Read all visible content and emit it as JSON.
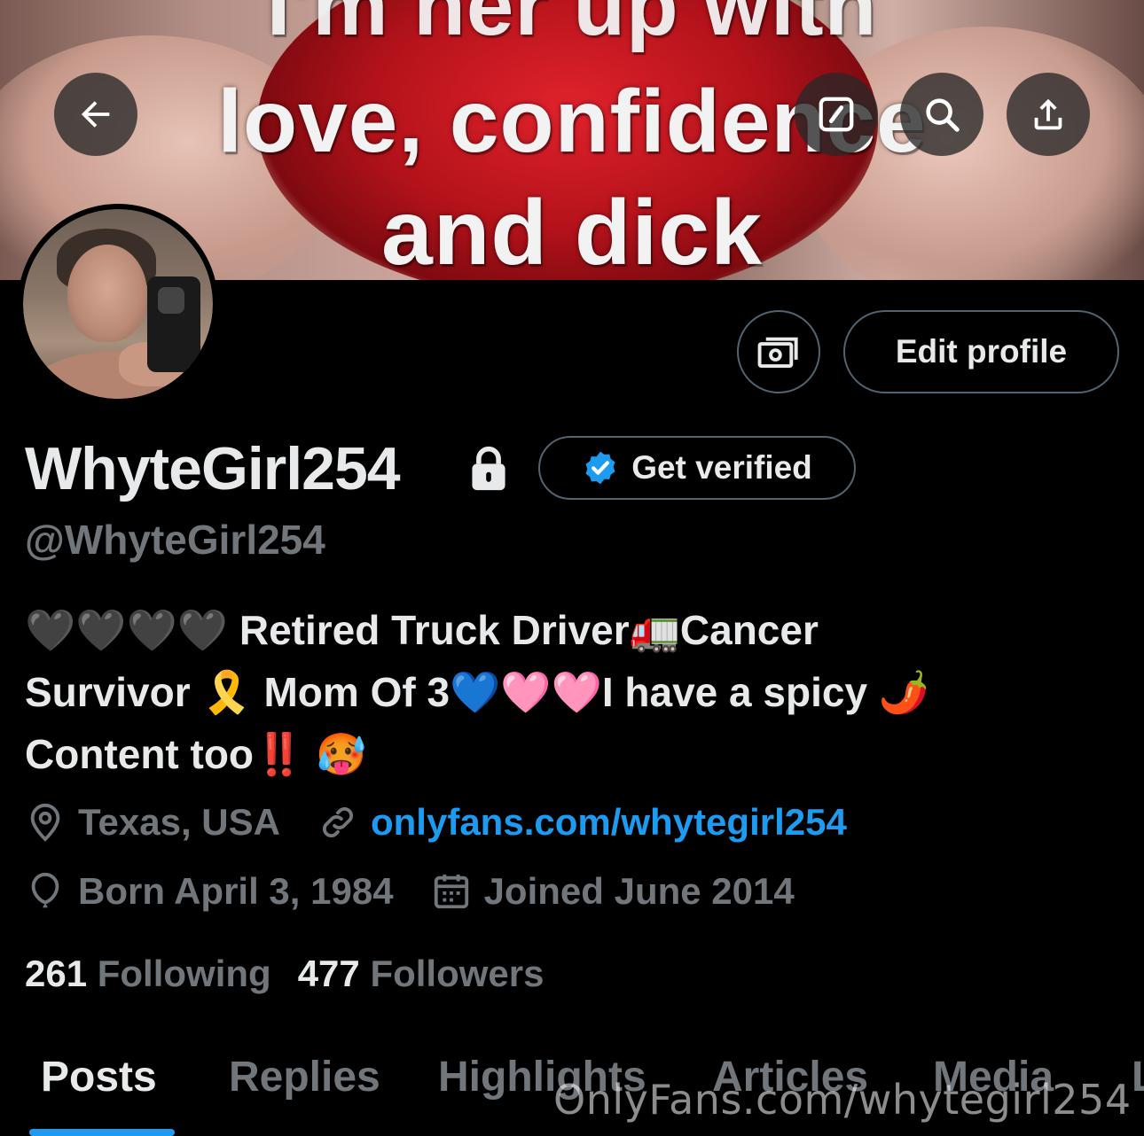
{
  "banner": {
    "line1": "I'm her up with",
    "line2": "love, confidence",
    "line3": "and dick"
  },
  "profile": {
    "display_name": "WhyteGirl254",
    "handle": "@WhyteGirl254",
    "bio_line1": "🖤🖤🖤🖤 Retired Truck Driver🚛Cancer",
    "bio_line2": "Survivor 🎗️ Mom Of 3💙🩷🩷I have a spicy 🌶️",
    "bio_line3": "Content too‼️ 🥵",
    "location": "Texas, USA",
    "website": "onlyfans.com/whytegirl254",
    "born": "Born April 3, 1984",
    "joined": "Joined June 2014",
    "following_count": "261",
    "following_label": "Following",
    "followers_count": "477",
    "followers_label": "Followers"
  },
  "buttons": {
    "edit_profile": "Edit profile",
    "get_verified": "Get verified"
  },
  "tabs": [
    "Posts",
    "Replies",
    "Highlights",
    "Articles",
    "Media",
    "L"
  ],
  "watermark": "OnlyFans.com/whytegirl254",
  "icons": {
    "back": "arrow-left-icon",
    "draft": "edit-square-icon",
    "search": "search-icon",
    "share": "share-upload-icon",
    "money": "money-tip-icon",
    "lock": "lock-icon",
    "verified": "verified-badge-icon",
    "location": "location-pin-icon",
    "link": "link-icon",
    "birthday": "balloon-icon",
    "calendar": "calendar-icon"
  },
  "colors": {
    "accent": "#1d9bf0",
    "muted": "#71767b",
    "text": "#e7e9ea",
    "background": "#000000"
  }
}
